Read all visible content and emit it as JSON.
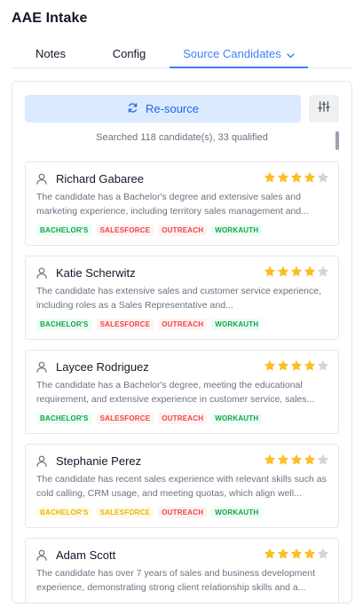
{
  "app": {
    "title": "AAE Intake"
  },
  "tabs": [
    {
      "label": "Notes"
    },
    {
      "label": "Config"
    },
    {
      "label": "Source Candidates"
    }
  ],
  "toolbar": {
    "resource_label": "Re-source",
    "resource_icon": "refresh-icon",
    "filter_icon": "sliders-icon"
  },
  "summary": "Searched 118 candidate(s), 33 qualified",
  "colors": {
    "accent": "#3b82f6",
    "star": "#fbbf24",
    "star_empty": "#d1d5db"
  },
  "candidates": [
    {
      "name": "Richard Gabaree",
      "rating": 4,
      "rating_max": 5,
      "description": "The candidate has a Bachelor's degree and extensive sales and marketing experience, including territory sales management and...",
      "tags": [
        {
          "label": "BACHELOR'S",
          "color": "green"
        },
        {
          "label": "SALESFORCE",
          "color": "red"
        },
        {
          "label": "OUTREACH",
          "color": "red"
        },
        {
          "label": "WORKAUTH",
          "color": "green"
        }
      ]
    },
    {
      "name": "Katie Scherwitz",
      "rating": 4,
      "rating_max": 5,
      "description": "The candidate has extensive sales and customer service experience, including roles as a Sales Representative and...",
      "tags": [
        {
          "label": "BACHELOR'S",
          "color": "green"
        },
        {
          "label": "SALESFORCE",
          "color": "red"
        },
        {
          "label": "OUTREACH",
          "color": "red"
        },
        {
          "label": "WORKAUTH",
          "color": "green"
        }
      ]
    },
    {
      "name": "Laycee Rodriguez",
      "rating": 4,
      "rating_max": 5,
      "description": "The candidate has a Bachelor's degree, meeting the educational requirement, and extensive experience in customer service, sales...",
      "tags": [
        {
          "label": "BACHELOR'S",
          "color": "green"
        },
        {
          "label": "SALESFORCE",
          "color": "red"
        },
        {
          "label": "OUTREACH",
          "color": "red"
        },
        {
          "label": "WORKAUTH",
          "color": "green"
        }
      ]
    },
    {
      "name": "Stephanie Perez",
      "rating": 4,
      "rating_max": 5,
      "description": "The candidate has recent sales experience with relevant skills such as cold calling, CRM usage, and meeting quotas, which align well...",
      "tags": [
        {
          "label": "BACHELOR'S",
          "color": "yellow"
        },
        {
          "label": "SALESFORCE",
          "color": "yellow"
        },
        {
          "label": "OUTREACH",
          "color": "red"
        },
        {
          "label": "WORKAUTH",
          "color": "green"
        }
      ]
    },
    {
      "name": "Adam Scott",
      "rating": 4,
      "rating_max": 5,
      "description": "The candidate has over 7 years of sales and business development experience, demonstrating strong client relationship skills and a...",
      "tags": []
    }
  ]
}
